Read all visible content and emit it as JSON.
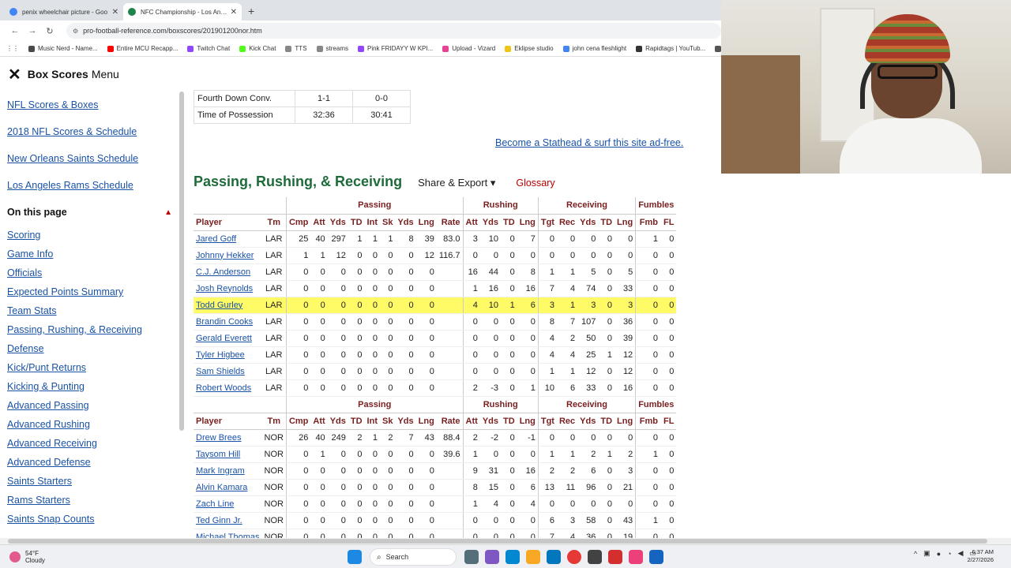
{
  "browser": {
    "tabs": [
      {
        "title": "penix wheelchair picture - Goo",
        "active": false,
        "icon_color": "#4285f4"
      },
      {
        "title": "NFC Championship - Los Angele",
        "active": true,
        "icon_color": "#1e8449"
      }
    ],
    "url": "pro-football-reference.com/boxscores/201901200nor.htm",
    "bookmarks": [
      {
        "label": "Music Nerd - Name...",
        "color": "#4a4a4a"
      },
      {
        "label": "Entire MCU Recapp...",
        "color": "#ff0000"
      },
      {
        "label": "Twitch Chat",
        "color": "#9146ff"
      },
      {
        "label": "Kick Chat",
        "color": "#53fc18"
      },
      {
        "label": "TTS",
        "color": "#888888"
      },
      {
        "label": "streams",
        "color": "#888888"
      },
      {
        "label": "Pink FRIDAYY W KPI...",
        "color": "#9146ff"
      },
      {
        "label": "Upload - Vizard",
        "color": "#e84393"
      },
      {
        "label": "Eklipse studio",
        "color": "#f0c419"
      },
      {
        "label": "john cena fleshlight",
        "color": "#4285f4"
      },
      {
        "label": "Rapidtags | YouTub...",
        "color": "#333333"
      },
      {
        "label": "bih links",
        "color": "#555555"
      }
    ]
  },
  "nav": {
    "title": "Box Scores",
    "menu": "Menu"
  },
  "sidebar": {
    "top_links": [
      "NFL Scores & Boxes",
      "2018 NFL Scores & Schedule",
      "New Orleans Saints Schedule",
      "Los Angeles Rams Schedule"
    ],
    "on_this_page": "On this page",
    "page_links": [
      "Scoring",
      "Game Info",
      "Officials",
      "Expected Points Summary",
      "Team Stats",
      "Passing, Rushing, & Receiving",
      "Defense",
      "Kick/Punt Returns",
      "Kicking & Punting",
      "Advanced Passing",
      "Advanced Rushing",
      "Advanced Receiving",
      "Advanced Defense",
      "Saints Starters",
      "Rams Starters",
      "Saints Snap Counts"
    ]
  },
  "team_stats": [
    {
      "label": "Fourth Down Conv.",
      "lar": "1-1",
      "nor": "0-0"
    },
    {
      "label": "Time of Possession",
      "lar": "32:36",
      "nor": "30:41"
    }
  ],
  "ad_link": "Become a Stathead & surf this site ad-free.",
  "section": {
    "title": "Passing, Rushing, & Receiving",
    "share": "Share & Export ▾",
    "glossary": "Glossary"
  },
  "table": {
    "groups": [
      "Passing",
      "Rushing",
      "Receiving",
      "Fumbles"
    ],
    "headers": [
      "Player",
      "Tm",
      "Cmp",
      "Att",
      "Yds",
      "TD",
      "Int",
      "Sk",
      "Yds",
      "Lng",
      "Rate",
      "Att",
      "Yds",
      "TD",
      "Lng",
      "Tgt",
      "Rec",
      "Yds",
      "TD",
      "Lng",
      "Fmb",
      "FL"
    ],
    "lar_rows": [
      [
        "Jared Goff",
        "LAR",
        "25",
        "40",
        "297",
        "1",
        "1",
        "1",
        "8",
        "39",
        "83.0",
        "3",
        "10",
        "0",
        "7",
        "0",
        "0",
        "0",
        "0",
        "0",
        "1",
        "0"
      ],
      [
        "Johnny Hekker",
        "LAR",
        "1",
        "1",
        "12",
        "0",
        "0",
        "0",
        "0",
        "12",
        "116.7",
        "0",
        "0",
        "0",
        "0",
        "0",
        "0",
        "0",
        "0",
        "0",
        "0",
        "0"
      ],
      [
        "C.J. Anderson",
        "LAR",
        "0",
        "0",
        "0",
        "0",
        "0",
        "0",
        "0",
        "0",
        "",
        "16",
        "44",
        "0",
        "8",
        "1",
        "1",
        "5",
        "0",
        "5",
        "0",
        "0"
      ],
      [
        "Josh Reynolds",
        "LAR",
        "0",
        "0",
        "0",
        "0",
        "0",
        "0",
        "0",
        "0",
        "",
        "1",
        "16",
        "0",
        "16",
        "7",
        "4",
        "74",
        "0",
        "33",
        "0",
        "0"
      ],
      [
        "Todd Gurley",
        "LAR",
        "0",
        "0",
        "0",
        "0",
        "0",
        "0",
        "0",
        "0",
        "",
        "4",
        "10",
        "1",
        "6",
        "3",
        "1",
        "3",
        "0",
        "3",
        "0",
        "0"
      ],
      [
        "Brandin Cooks",
        "LAR",
        "0",
        "0",
        "0",
        "0",
        "0",
        "0",
        "0",
        "0",
        "",
        "0",
        "0",
        "0",
        "0",
        "8",
        "7",
        "107",
        "0",
        "36",
        "0",
        "0"
      ],
      [
        "Gerald Everett",
        "LAR",
        "0",
        "0",
        "0",
        "0",
        "0",
        "0",
        "0",
        "0",
        "",
        "0",
        "0",
        "0",
        "0",
        "4",
        "2",
        "50",
        "0",
        "39",
        "0",
        "0"
      ],
      [
        "Tyler Higbee",
        "LAR",
        "0",
        "0",
        "0",
        "0",
        "0",
        "0",
        "0",
        "0",
        "",
        "0",
        "0",
        "0",
        "0",
        "4",
        "4",
        "25",
        "1",
        "12",
        "0",
        "0"
      ],
      [
        "Sam Shields",
        "LAR",
        "0",
        "0",
        "0",
        "0",
        "0",
        "0",
        "0",
        "0",
        "",
        "0",
        "0",
        "0",
        "0",
        "1",
        "1",
        "12",
        "0",
        "12",
        "0",
        "0"
      ],
      [
        "Robert Woods",
        "LAR",
        "0",
        "0",
        "0",
        "0",
        "0",
        "0",
        "0",
        "0",
        "",
        "2",
        "-3",
        "0",
        "1",
        "10",
        "6",
        "33",
        "0",
        "16",
        "0",
        "0"
      ]
    ],
    "nor_rows": [
      [
        "Drew Brees",
        "NOR",
        "26",
        "40",
        "249",
        "2",
        "1",
        "2",
        "7",
        "43",
        "88.4",
        "2",
        "-2",
        "0",
        "-1",
        "0",
        "0",
        "0",
        "0",
        "0",
        "0",
        "0"
      ],
      [
        "Taysom Hill",
        "NOR",
        "0",
        "1",
        "0",
        "0",
        "0",
        "0",
        "0",
        "0",
        "39.6",
        "1",
        "0",
        "0",
        "0",
        "1",
        "1",
        "2",
        "1",
        "2",
        "1",
        "0"
      ],
      [
        "Mark Ingram",
        "NOR",
        "0",
        "0",
        "0",
        "0",
        "0",
        "0",
        "0",
        "0",
        "",
        "9",
        "31",
        "0",
        "16",
        "2",
        "2",
        "6",
        "0",
        "3",
        "0",
        "0"
      ],
      [
        "Alvin Kamara",
        "NOR",
        "0",
        "0",
        "0",
        "0",
        "0",
        "0",
        "0",
        "0",
        "",
        "8",
        "15",
        "0",
        "6",
        "13",
        "11",
        "96",
        "0",
        "21",
        "0",
        "0"
      ],
      [
        "Zach Line",
        "NOR",
        "0",
        "0",
        "0",
        "0",
        "0",
        "0",
        "0",
        "0",
        "",
        "1",
        "4",
        "0",
        "4",
        "0",
        "0",
        "0",
        "0",
        "0",
        "0",
        "0"
      ],
      [
        "Ted Ginn Jr.",
        "NOR",
        "0",
        "0",
        "0",
        "0",
        "0",
        "0",
        "0",
        "0",
        "",
        "0",
        "0",
        "0",
        "0",
        "6",
        "3",
        "58",
        "0",
        "43",
        "1",
        "0"
      ],
      [
        "Michael Thomas",
        "NOR",
        "0",
        "0",
        "0",
        "0",
        "0",
        "0",
        "0",
        "0",
        "",
        "0",
        "0",
        "0",
        "0",
        "7",
        "4",
        "36",
        "0",
        "19",
        "0",
        "0"
      ]
    ],
    "highlight_player": "Todd Gurley"
  },
  "taskbar": {
    "weather_temp": "54°F",
    "weather_desc": "Cloudy",
    "search": "Search",
    "time": "6:37 AM",
    "date": "2/27/2026"
  }
}
